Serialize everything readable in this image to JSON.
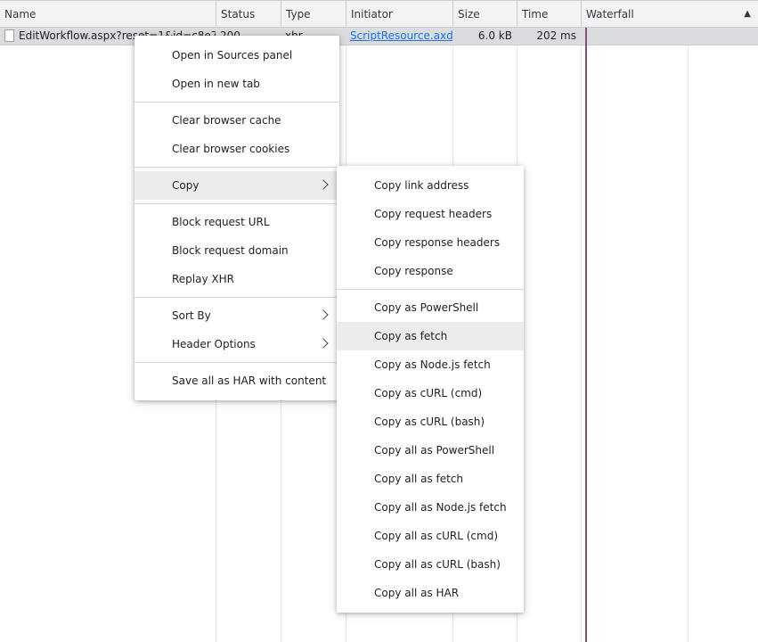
{
  "table": {
    "columns": [
      {
        "key": "name",
        "label": "Name"
      },
      {
        "key": "status",
        "label": "Status"
      },
      {
        "key": "type",
        "label": "Type"
      },
      {
        "key": "initiator",
        "label": "Initiator"
      },
      {
        "key": "size",
        "label": "Size"
      },
      {
        "key": "time",
        "label": "Time"
      },
      {
        "key": "waterfall",
        "label": "Waterfall"
      }
    ],
    "sort_indicator": "▲",
    "row": {
      "name": "EditWorkflow.aspx?reset=1&id=c8e7f",
      "status": "200",
      "type": "xhr",
      "initiator": "ScriptResource.axd...",
      "size": "6.0 kB",
      "time": "202 ms"
    }
  },
  "context_menu": {
    "group1": [
      "Open in Sources panel",
      "Open in new tab"
    ],
    "group2": [
      "Clear browser cache",
      "Clear browser cookies"
    ],
    "copy": "Copy",
    "group4": [
      "Block request URL",
      "Block request domain",
      "Replay XHR"
    ],
    "sort_by": "Sort By",
    "header_options": "Header Options",
    "save_har": "Save all as HAR with content"
  },
  "copy_submenu": {
    "group1": [
      "Copy link address",
      "Copy request headers",
      "Copy response headers",
      "Copy response"
    ],
    "group2": [
      "Copy as PowerShell",
      "Copy as fetch",
      "Copy as Node.js fetch",
      "Copy as cURL (cmd)",
      "Copy as cURL (bash)",
      "Copy all as PowerShell",
      "Copy all as fetch",
      "Copy all as Node.js fetch",
      "Copy all as cURL (cmd)",
      "Copy all as cURL (bash)",
      "Copy all as HAR"
    ],
    "highlighted": "Copy as fetch"
  }
}
